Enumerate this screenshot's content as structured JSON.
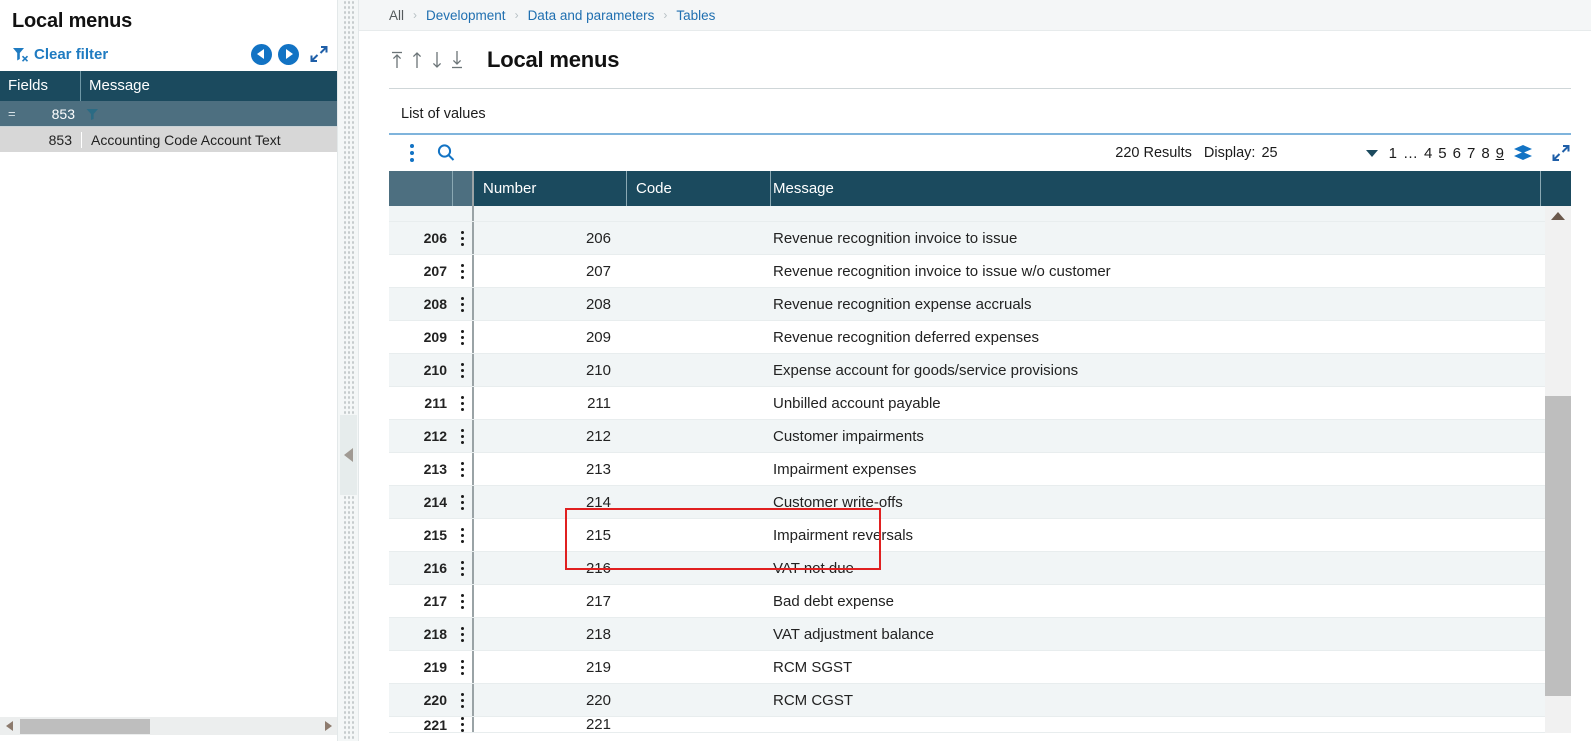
{
  "left_panel": {
    "title": "Local menus",
    "clear_filter_label": "Clear filter",
    "clear_filter_icon": "funnel-x-icon",
    "nav_prev_icon": "circle-arrow-left-icon",
    "nav_next_icon": "circle-arrow-right-icon",
    "expand_icon": "expand-diagonal-icon",
    "columns": [
      "Fields",
      "Message"
    ],
    "filter_row": {
      "operator": "=",
      "value": "853",
      "filter_icon": "funnel-icon"
    },
    "rows": [
      {
        "number": "853",
        "message": "Accounting Code Account Text"
      }
    ],
    "hscroll": {
      "left_arrow_icon": "arrow-left-icon",
      "right_arrow_icon": "arrow-right-icon"
    }
  },
  "splitter": {
    "collapse_icon": "triangle-left-icon"
  },
  "breadcrumb": {
    "items": [
      "All",
      "Development",
      "Data and parameters",
      "Tables"
    ],
    "separator": "›"
  },
  "page": {
    "title": "Local menus",
    "nav_icons": [
      "first-record-icon",
      "previous-record-icon",
      "next-record-icon",
      "last-record-icon"
    ]
  },
  "section": {
    "title": "List of values"
  },
  "grid_toolbar": {
    "kebab_icon": "more-options-icon",
    "search_icon": "search-icon",
    "results_label": "220 Results",
    "display_label": "Display:",
    "display_value": "25",
    "dropdown_icon": "caret-down-icon",
    "pages": [
      "1",
      "…",
      "4",
      "5",
      "6",
      "7",
      "8",
      "9"
    ],
    "current_page": "9",
    "layers_icon": "layers-icon",
    "expand_icon": "expand-diagonal-icon"
  },
  "grid": {
    "columns": [
      "",
      "",
      "Number",
      "Code",
      "Message"
    ],
    "rows": [
      {
        "rownum": "206",
        "number": "206",
        "code": "",
        "message": "Revenue recognition invoice to issue"
      },
      {
        "rownum": "207",
        "number": "207",
        "code": "",
        "message": "Revenue recognition invoice to issue w/o customer"
      },
      {
        "rownum": "208",
        "number": "208",
        "code": "",
        "message": "Revenue recognition expense accruals"
      },
      {
        "rownum": "209",
        "number": "209",
        "code": "",
        "message": "Revenue recognition deferred expenses"
      },
      {
        "rownum": "210",
        "number": "210",
        "code": "",
        "message": "Expense account for goods/service provisions"
      },
      {
        "rownum": "211",
        "number": "211",
        "code": "",
        "message": "Unbilled account payable"
      },
      {
        "rownum": "212",
        "number": "212",
        "code": "",
        "message": "Customer impairments"
      },
      {
        "rownum": "213",
        "number": "213",
        "code": "",
        "message": "Impairment expenses"
      },
      {
        "rownum": "214",
        "number": "214",
        "code": "",
        "message": "Customer write-offs"
      },
      {
        "rownum": "215",
        "number": "215",
        "code": "",
        "message": "Impairment reversals"
      },
      {
        "rownum": "216",
        "number": "216",
        "code": "",
        "message": "VAT not due"
      },
      {
        "rownum": "217",
        "number": "217",
        "code": "",
        "message": "Bad debt expense"
      },
      {
        "rownum": "218",
        "number": "218",
        "code": "",
        "message": "VAT adjustment balance"
      },
      {
        "rownum": "219",
        "number": "219",
        "code": "",
        "message": "RCM SGST"
      },
      {
        "rownum": "220",
        "number": "220",
        "code": "",
        "message": "RCM CGST"
      },
      {
        "rownum": "221",
        "number": "221",
        "code": "",
        "message": ""
      }
    ],
    "scrollbar": {
      "up_arrow_icon": "arrow-up-icon"
    }
  },
  "colors": {
    "header_dark": "#1b4a5e",
    "header_light": "#4d6f80",
    "accent_blue": "#1273c4",
    "link_blue": "#1f6fb0",
    "rule_blue": "#7fb4dc",
    "highlight_red": "#e02020",
    "row_alt": "#f1f5f6"
  }
}
